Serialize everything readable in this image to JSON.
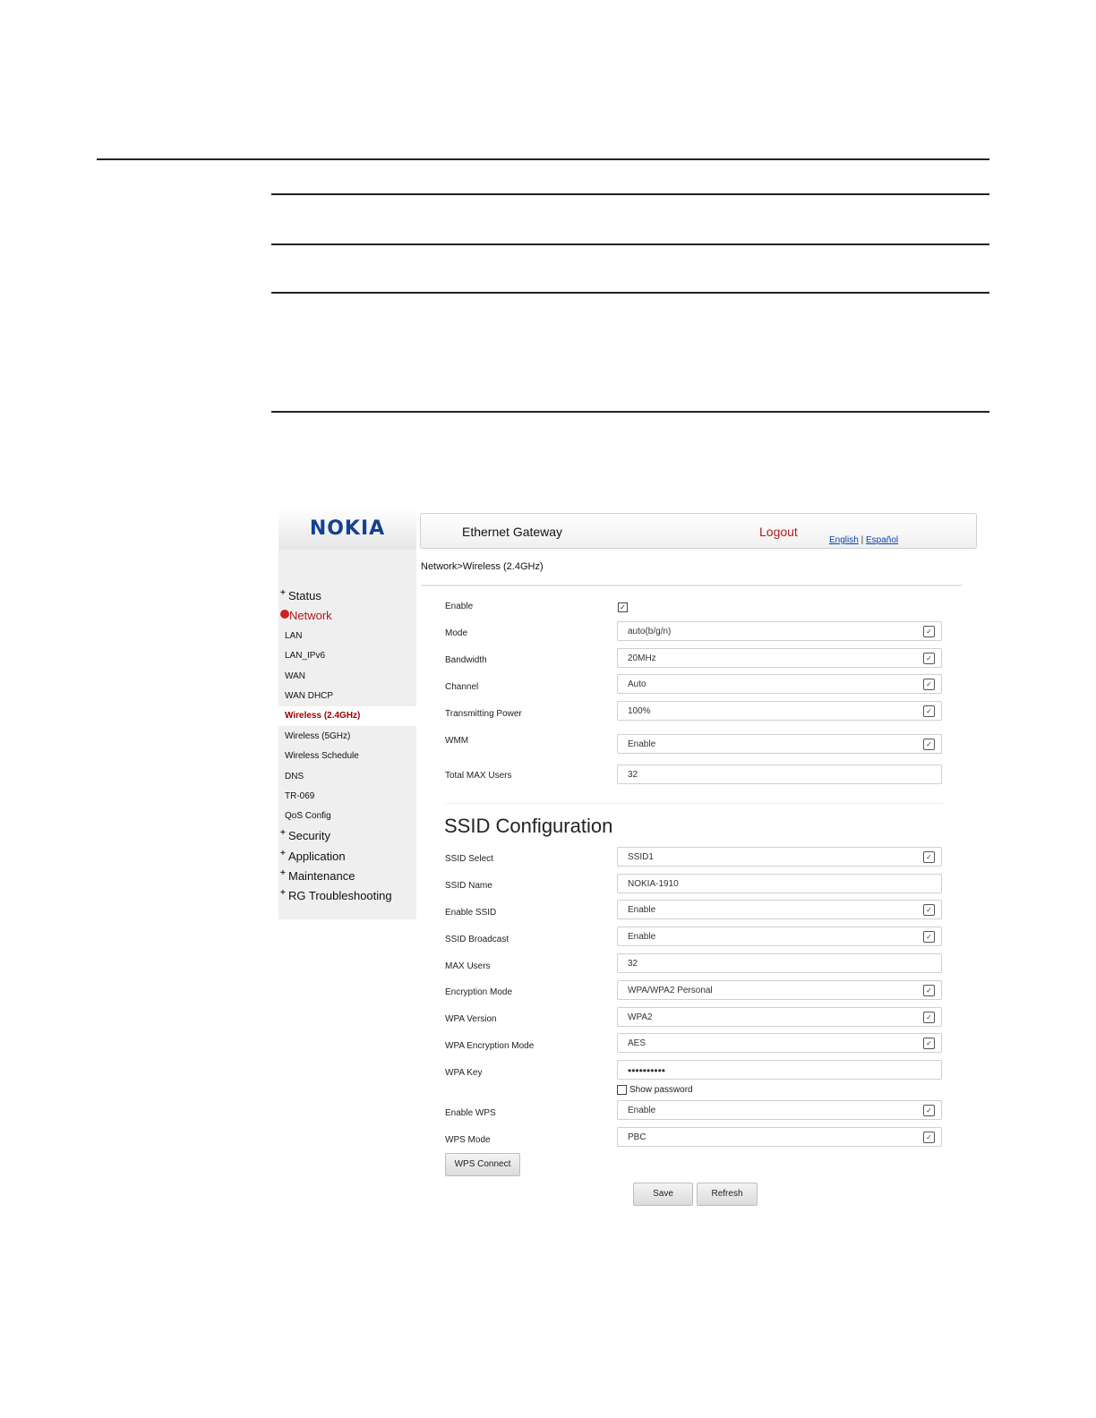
{
  "brand": {
    "logo_text": "NOKIA"
  },
  "header": {
    "title": "Ethernet Gateway",
    "logout": "Logout",
    "lang_english": "English",
    "lang_sep": "|",
    "lang_spanish": "Español"
  },
  "breadcrumb": "Network>Wireless (2.4GHz)",
  "sidebar": {
    "status": "Status",
    "network": "Network",
    "network_items": [
      "LAN",
      "LAN_IPv6",
      "WAN",
      "WAN DHCP",
      "Wireless (2.4GHz)",
      "Wireless (5GHz)",
      "Wireless Schedule",
      "DNS",
      "TR-069",
      "QoS Config"
    ],
    "security": "Security",
    "application": "Application",
    "maintenance": "Maintenance",
    "rg_troubleshooting": "RG Troubleshooting"
  },
  "wireless": {
    "enable_label": "Enable",
    "enable_checked": true,
    "mode_label": "Mode",
    "mode_value": "auto(b/g/n)",
    "bandwidth_label": "Bandwidth",
    "bandwidth_value": "20MHz",
    "channel_label": "Channel",
    "channel_value": "Auto",
    "tx_power_label": "Transmitting Power",
    "tx_power_value": "100%",
    "wmm_label": "WMM",
    "wmm_value": "Enable",
    "total_max_users_label": "Total MAX Users",
    "total_max_users_value": "32"
  },
  "ssid": {
    "title": "SSID Configuration",
    "select_label": "SSID Select",
    "select_value": "SSID1",
    "name_label": "SSID Name",
    "name_value": "NOKIA-1910",
    "enable_label": "Enable SSID",
    "enable_value": "Enable",
    "broadcast_label": "SSID Broadcast",
    "broadcast_value": "Enable",
    "max_users_label": "MAX Users",
    "max_users_value": "32",
    "enc_mode_label": "Encryption Mode",
    "enc_mode_value": "WPA/WPA2 Personal",
    "wpa_version_label": "WPA Version",
    "wpa_version_value": "WPA2",
    "wpa_enc_mode_label": "WPA Encryption Mode",
    "wpa_enc_mode_value": "AES",
    "wpa_key_label": "WPA Key",
    "wpa_key_value": "••••••••••",
    "show_password_label": "Show password",
    "enable_wps_label": "Enable WPS",
    "enable_wps_value": "Enable",
    "wps_mode_label": "WPS Mode",
    "wps_mode_value": "PBC"
  },
  "buttons": {
    "wps_connect": "WPS Connect",
    "save": "Save",
    "refresh": "Refresh"
  }
}
